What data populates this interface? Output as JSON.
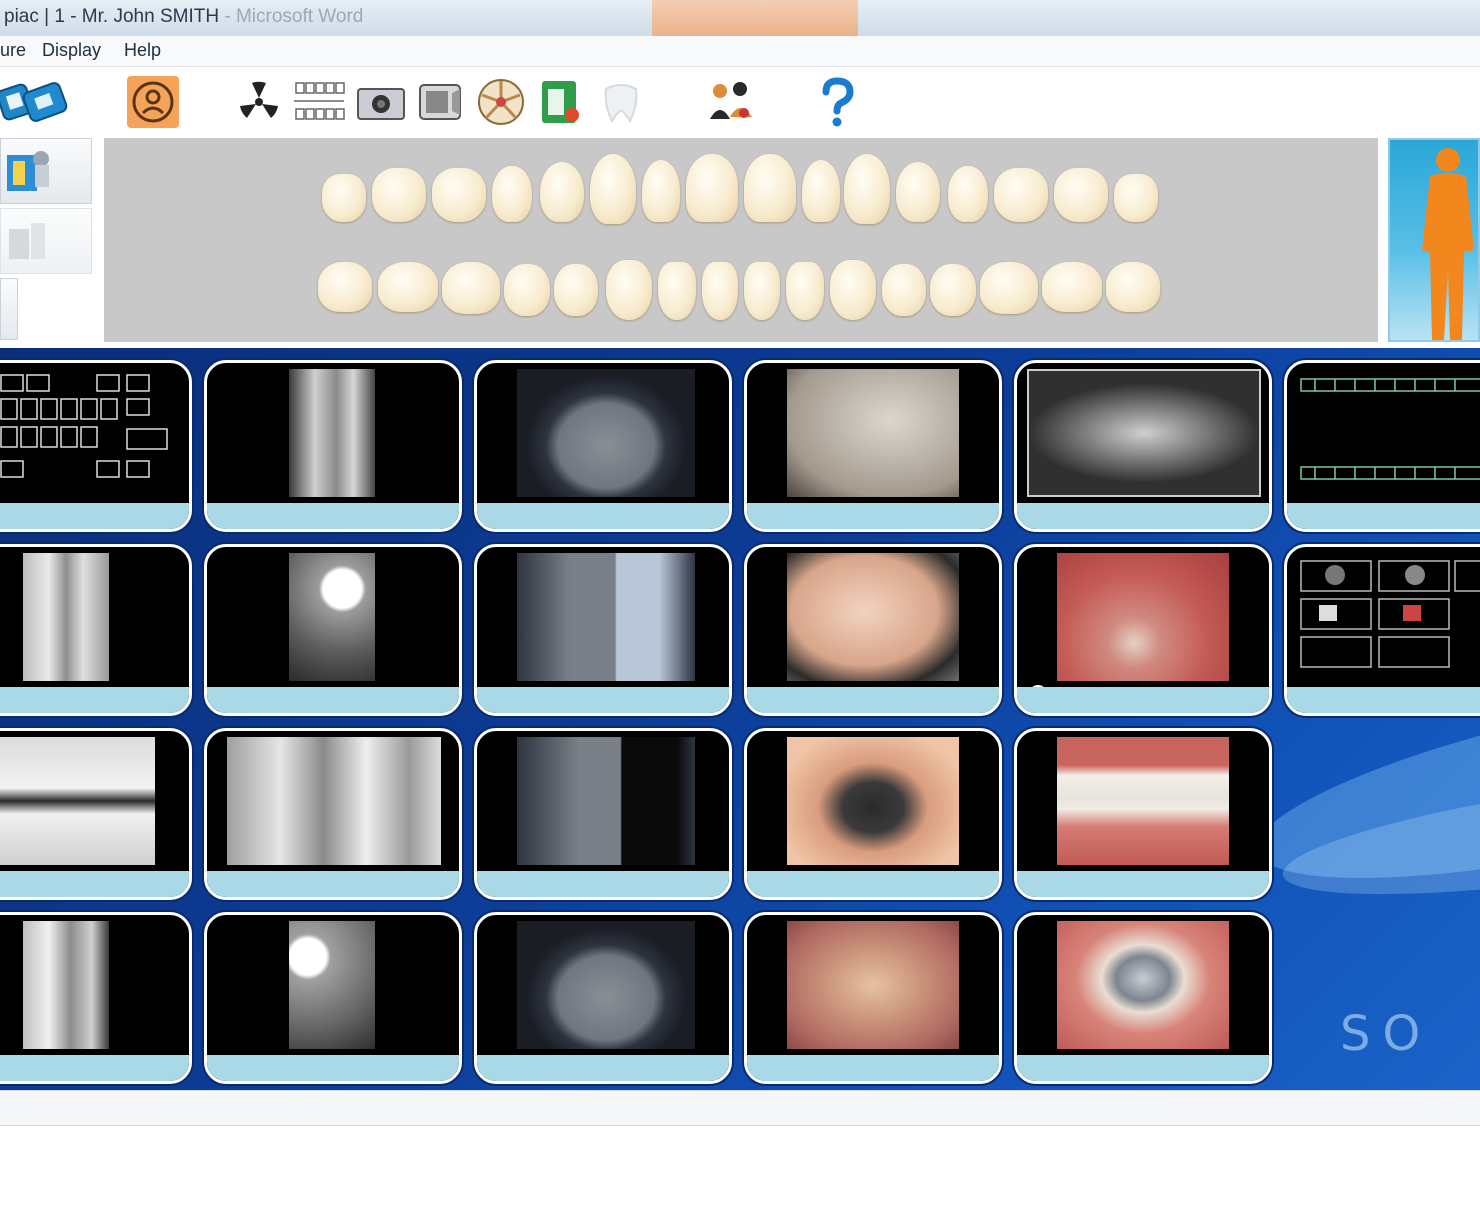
{
  "window": {
    "title": "piac | 1 - Mr. John SMITH",
    "title_suffix": "- Microsoft Word"
  },
  "menu": {
    "items": [
      "ure",
      "Display",
      "Help"
    ]
  },
  "toolbar": {
    "icons": [
      "patient-folder-icon",
      "dental-chair-icon",
      "radiation-icon",
      "dental-chart-icon",
      "camera-icon",
      "scanner-icon",
      "color-wheel-icon",
      "intraoral-camera-icon",
      "tooth-icon",
      "people-icon",
      "help-icon"
    ]
  },
  "gallery": {
    "watermark": "SO",
    "rows": [
      [
        "fmx-template",
        "periapical-xray",
        "occlusal-phosphor-plate",
        "intraoral-photo",
        "panoramic-xray",
        "fmx-template-2"
      ],
      [
        "bitewing-xray",
        "periapical-crown-xray",
        "occlusal-phosphor-plate",
        "intraoral-photo-caries",
        "intraoral-photo-gums",
        "fmx-template-3"
      ],
      [
        "bitewing-xray-wide",
        "bitewing-xray-2",
        "occlusal-phosphor-plate",
        "intraoral-photo-cavity",
        "intraoral-photo-smile"
      ],
      [
        "periapical-xray-2",
        "periapical-xray-3",
        "occlusal-phosphor-plate",
        "intraoral-photo-prep",
        "intraoral-photo-amalgam"
      ]
    ]
  },
  "colors": {
    "gallery_bg": "#0c3c96",
    "caption_bg": "#a9d8e6",
    "avatar_bg": "#2aa7d8",
    "avatar_figure": "#f2871e"
  }
}
